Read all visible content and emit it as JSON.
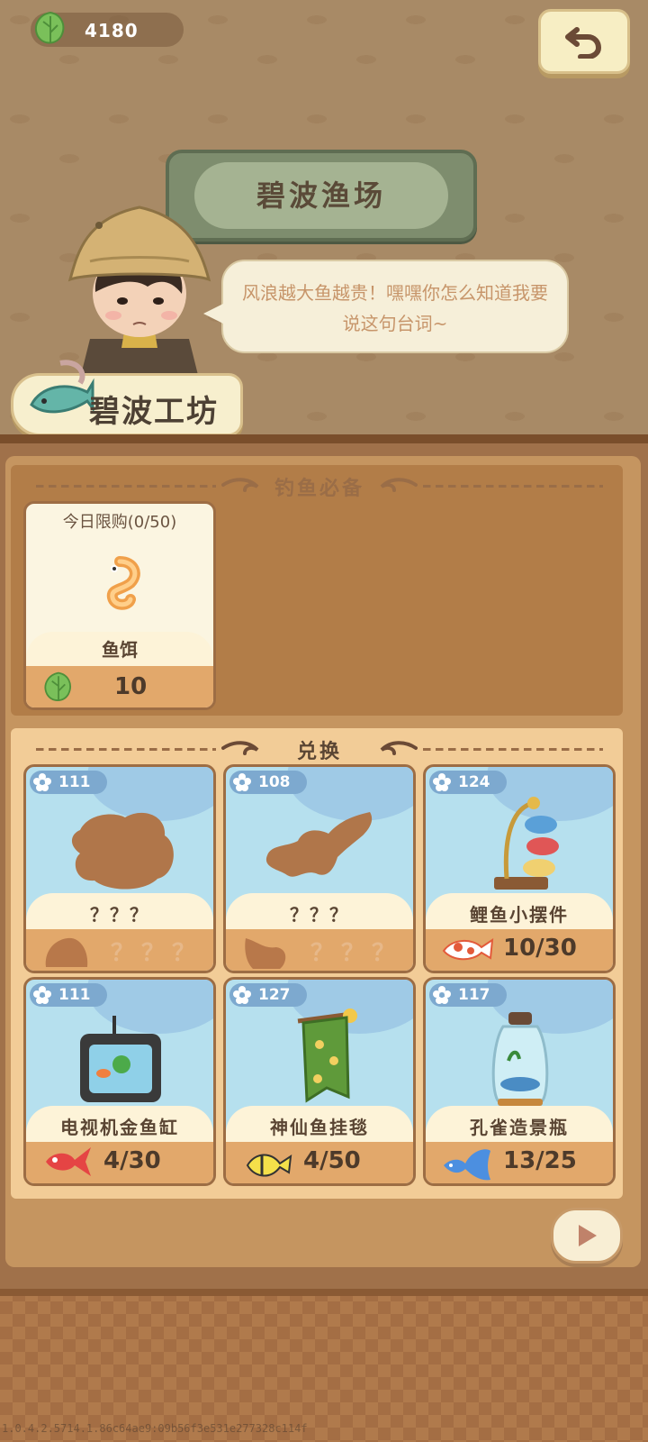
{
  "currency": {
    "amount": "4180",
    "icon": "leaf-icon"
  },
  "header": {
    "title": "碧波渔场",
    "back_icon": "undo-arrow-icon"
  },
  "npc": {
    "dialogue": "风浪越大鱼越贵！嘿嘿你怎么知道我要说这句台词~"
  },
  "shop": {
    "name": "碧波工坊"
  },
  "section_essentials": {
    "title": "钓鱼必备",
    "item": {
      "limit": "今日限购(0/50)",
      "name": "鱼饵",
      "price": "10",
      "price_icon": "leaf-icon",
      "icon": "bait-icon"
    }
  },
  "section_exchange": {
    "title": "兑换",
    "items": [
      {
        "level": "111",
        "name": "？？？",
        "progress": "？？？",
        "locked": true
      },
      {
        "level": "108",
        "name": "？？？",
        "progress": "？？？",
        "locked": true
      },
      {
        "level": "124",
        "name": "鲤鱼小摆件",
        "progress": "10/30",
        "locked": false
      },
      {
        "level": "111",
        "name": "电视机金鱼缸",
        "progress": "4/30",
        "locked": false
      },
      {
        "level": "127",
        "name": "神仙鱼挂毯",
        "progress": "4/50",
        "locked": false
      },
      {
        "level": "117",
        "name": "孔雀造景瓶",
        "progress": "13/25",
        "locked": false
      }
    ]
  },
  "footer": {
    "version": "1.0.4.2.5714.1.86c64ae9:09b56f3e531e277328c114f"
  },
  "colors": {
    "accent": "#e2a86b",
    "panel": "#c59560",
    "sky": "#b6e0ee"
  }
}
